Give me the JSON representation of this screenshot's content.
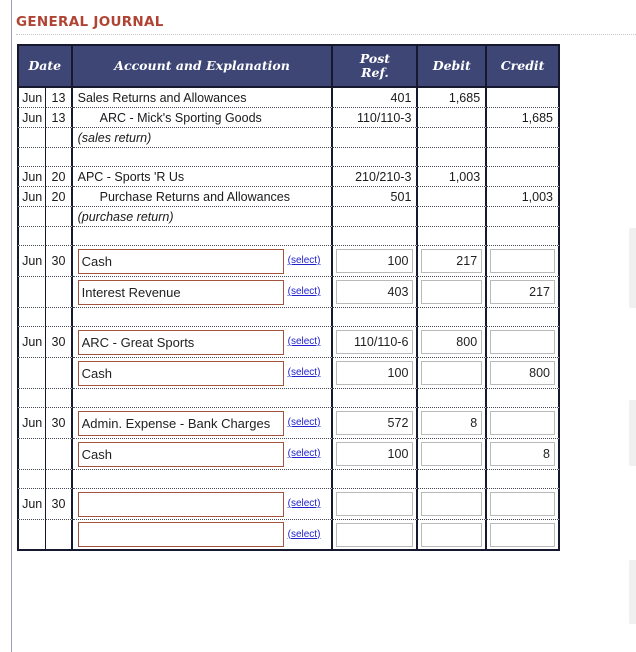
{
  "page": {
    "title": "GENERAL JOURNAL"
  },
  "table": {
    "headers": {
      "date": "Date",
      "account": "Account and Explanation",
      "post_ref_line1": "Post",
      "post_ref_line2": "Ref.",
      "debit": "Debit",
      "credit": "Credit"
    },
    "select_label": "(select)",
    "rows": [
      {
        "kind": "text",
        "month": "Jun",
        "day": "13",
        "account": "Sales Returns and Allowances",
        "indent": false,
        "memo": false,
        "post": "401",
        "debit": "1,685",
        "credit": ""
      },
      {
        "kind": "text",
        "month": "Jun",
        "day": "13",
        "account": "ARC - Mick's Sporting Goods",
        "indent": true,
        "memo": false,
        "post": "110/110-3",
        "debit": "",
        "credit": "1,685"
      },
      {
        "kind": "text",
        "month": "",
        "day": "",
        "account": "(sales return)",
        "indent": false,
        "memo": true,
        "post": "",
        "debit": "",
        "credit": ""
      },
      {
        "kind": "spacer"
      },
      {
        "kind": "text",
        "month": "Jun",
        "day": "20",
        "account": "APC - Sports 'R Us",
        "indent": false,
        "memo": false,
        "post": "210/210-3",
        "debit": "1,003",
        "credit": ""
      },
      {
        "kind": "text",
        "month": "Jun",
        "day": "20",
        "account": "Purchase Returns and Allowances",
        "indent": true,
        "memo": false,
        "post": "501",
        "debit": "",
        "credit": "1,003"
      },
      {
        "kind": "text",
        "month": "",
        "day": "",
        "account": "(purchase return)",
        "indent": false,
        "memo": true,
        "post": "",
        "debit": "",
        "credit": ""
      },
      {
        "kind": "spacer"
      },
      {
        "kind": "input",
        "month": "Jun",
        "day": "30",
        "account": "Cash",
        "post": "100",
        "debit": "217",
        "credit": ""
      },
      {
        "kind": "input",
        "month": "",
        "day": "",
        "account": "Interest Revenue",
        "post": "403",
        "debit": "",
        "credit": "217"
      },
      {
        "kind": "spacer"
      },
      {
        "kind": "input",
        "month": "Jun",
        "day": "30",
        "account": "ARC - Great Sports",
        "post": "110/110-6",
        "debit": "800",
        "credit": ""
      },
      {
        "kind": "input",
        "month": "",
        "day": "",
        "account": "Cash",
        "post": "100",
        "debit": "",
        "credit": "800"
      },
      {
        "kind": "spacer"
      },
      {
        "kind": "input",
        "month": "Jun",
        "day": "30",
        "account": "Admin. Expense - Bank Charges",
        "post": "572",
        "debit": "8",
        "credit": ""
      },
      {
        "kind": "input",
        "month": "",
        "day": "",
        "account": "Cash",
        "post": "100",
        "debit": "",
        "credit": "8"
      },
      {
        "kind": "spacer"
      },
      {
        "kind": "input",
        "month": "Jun",
        "day": "30",
        "account": "",
        "post": "",
        "debit": "",
        "credit": ""
      },
      {
        "kind": "input",
        "month": "",
        "day": "",
        "account": "",
        "post": "",
        "debit": "",
        "credit": ""
      }
    ]
  },
  "colors": {
    "title": "#b04434",
    "header_bg": "#3e4675",
    "account_input_border": "#a2543e",
    "link": "#2222cc"
  }
}
